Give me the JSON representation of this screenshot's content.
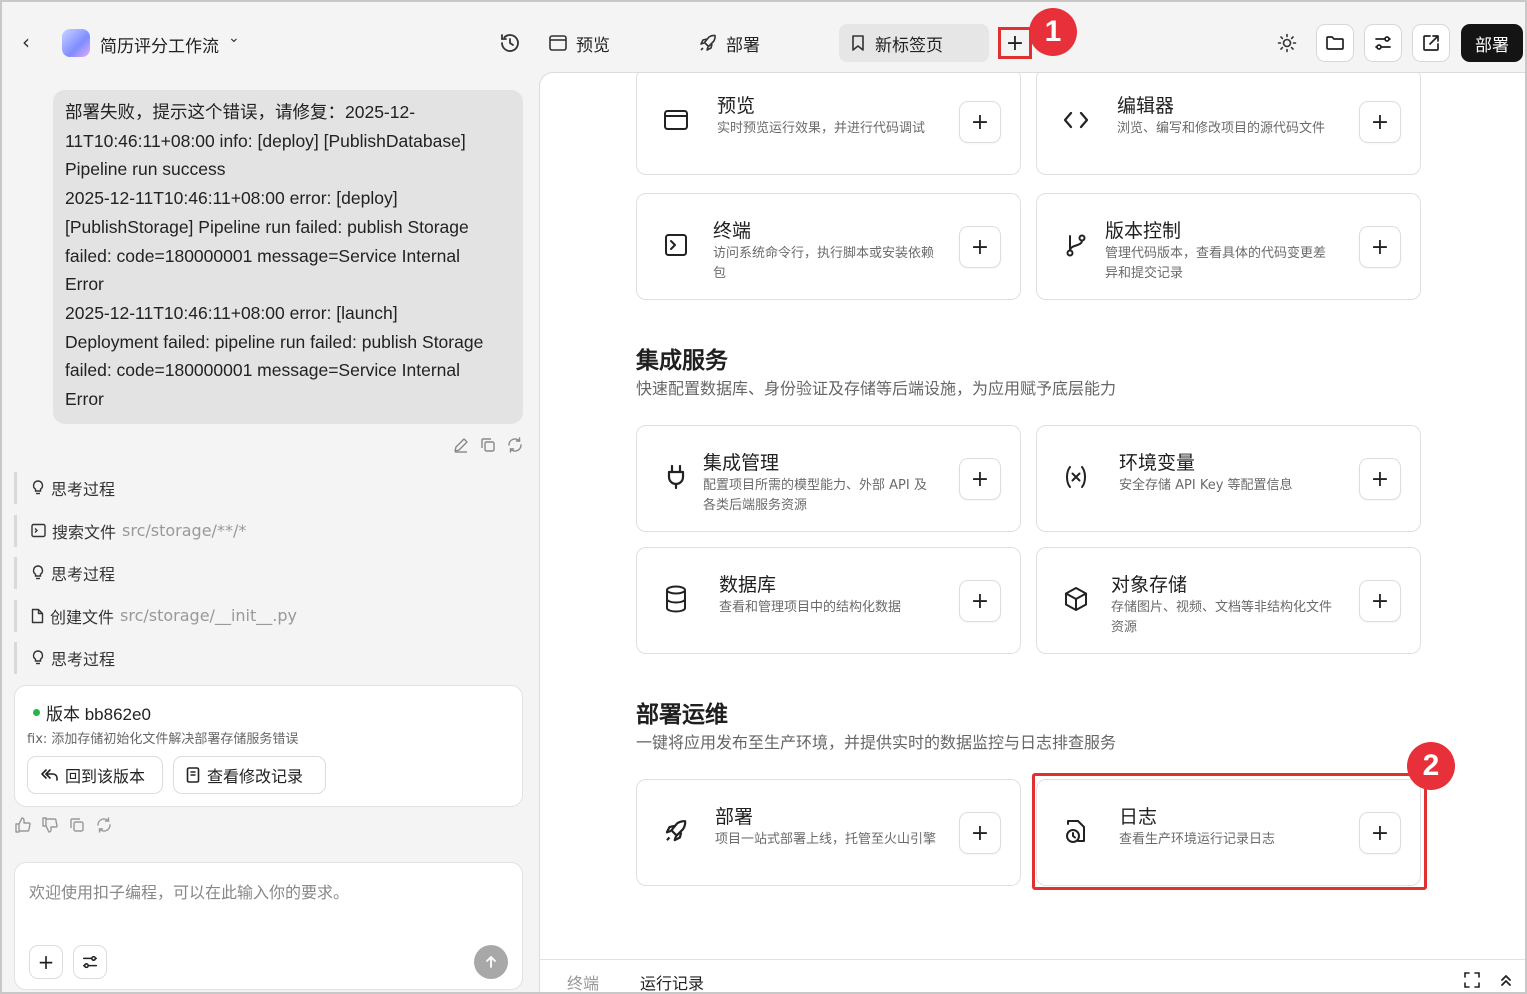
{
  "header": {
    "project_name": "简历评分工作流",
    "tabs": [
      {
        "label": "预览"
      },
      {
        "label": "部署"
      },
      {
        "label": "新标签页"
      }
    ],
    "add_tab_label": "+",
    "deploy_label": "部署",
    "annotation_1": "1",
    "annotation_2": "2"
  },
  "chat": {
    "message_lines": [
      "部署失败，提示这个错误，请修复：2025-12-",
      "11T10:46:11+08:00 info: [deploy] [PublishDatabase]",
      "Pipeline run success",
      "2025-12-11T10:46:11+08:00 error: [deploy]",
      "[PublishStorage] Pipeline run failed: publish Storage",
      "failed: code=180000001 message=Service Internal",
      "Error",
      "2025-12-11T10:46:11+08:00 error: [launch]",
      "Deployment failed: pipeline run failed: publish Storage",
      "failed: code=180000001 message=Service Internal",
      "Error"
    ],
    "steps": [
      {
        "icon": "bulb-icon",
        "label": "思考过程",
        "detail": ""
      },
      {
        "icon": "terminal-icon",
        "label": "搜索文件",
        "detail": "src/storage/**/*"
      },
      {
        "icon": "bulb-icon",
        "label": "思考过程",
        "detail": ""
      },
      {
        "icon": "file-icon",
        "label": "创建文件",
        "detail": "src/storage/__init__.py"
      },
      {
        "icon": "bulb-icon",
        "label": "思考过程",
        "detail": ""
      }
    ],
    "version": {
      "title": "版本 bb862e0",
      "description": "fix: 添加存储初始化文件解决部署存储服务错误",
      "restore_label": "回到该版本",
      "diff_label": "查看修改记录"
    },
    "input_placeholder": "欢迎使用扣子编程，可以在此输入你的要求。"
  },
  "panel": {
    "dev_cards": [
      {
        "title": "预览",
        "desc": "实时预览运行效果，并进行代码调试"
      },
      {
        "title": "编辑器",
        "desc": "浏览、编写和修改项目的源代码文件"
      },
      {
        "title": "终端",
        "desc": "访问系统命令行，执行脚本或安装依赖包"
      },
      {
        "title": "版本控制",
        "desc": "管理代码版本，查看具体的代码变更差异和提交记录"
      }
    ],
    "integration": {
      "title": "集成服务",
      "subtitle": "快速配置数据库、身份验证及存储等后端设施，为应用赋予底层能力",
      "cards": [
        {
          "title": "集成管理",
          "desc": "配置项目所需的模型能力、外部 API 及各类后端服务资源"
        },
        {
          "title": "环境变量",
          "desc": "安全存储 API Key 等配置信息"
        },
        {
          "title": "数据库",
          "desc": "查看和管理项目中的结构化数据"
        },
        {
          "title": "对象存储",
          "desc": "存储图片、视频、文档等非结构化文件资源"
        }
      ]
    },
    "ops": {
      "title": "部署运维",
      "subtitle": "一键将应用发布至生产环境，并提供实时的数据监控与日志排查服务",
      "cards": [
        {
          "title": "部署",
          "desc": "项目一站式部署上线，托管至火山引擎"
        },
        {
          "title": "日志",
          "desc": "查看生产环境运行记录日志"
        }
      ]
    },
    "bottom_tabs": {
      "terminal": "终端",
      "run_logs": "运行记录"
    }
  },
  "colors": {
    "highlight": "#e03131",
    "badge": "#e8303a",
    "primary_button": "#141414",
    "version_dot": "#28b446"
  }
}
